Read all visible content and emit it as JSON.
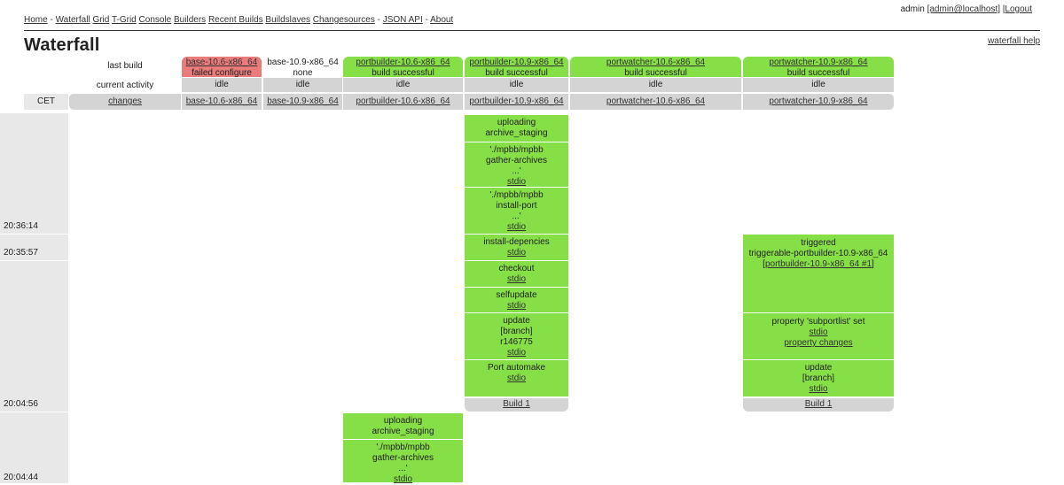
{
  "nav": {
    "items": [
      "Home",
      "Waterfall",
      "Grid",
      "T-Grid",
      "Console",
      "Builders",
      "Recent Builds",
      "Buildslaves",
      "Changesources",
      "JSON API",
      "About"
    ]
  },
  "auth": {
    "user": "admin",
    "login": "[admin@localhost]",
    "logout": "Logout"
  },
  "page": {
    "title": "Waterfall",
    "help": "waterfall help"
  },
  "rows": {
    "last_build": "last build",
    "current_activity": "current activity",
    "timezone": "CET",
    "changes": "changes"
  },
  "builders": [
    {
      "name": "base-10.6-x86_64",
      "status": "failed configure",
      "activity": "idle"
    },
    {
      "name": "base-10.9-x86_64",
      "status": "none",
      "activity": "idle"
    },
    {
      "name": "portbuilder-10.6-x86_64",
      "status": "build successful",
      "activity": "idle"
    },
    {
      "name": "portbuilder-10.9-x86_64",
      "status": "build successful",
      "activity": "idle"
    },
    {
      "name": "portwatcher-10.6-x86_64",
      "status": "build successful",
      "activity": "idle"
    },
    {
      "name": "portwatcher-10.9-x86_64",
      "status": "build successful",
      "activity": "idle"
    }
  ],
  "times": [
    "20:36:14",
    "20:35:57",
    "20:04:56",
    "20:04:44"
  ],
  "pb109": {
    "s1": [
      "uploading",
      "archive_staging"
    ],
    "s2": [
      "'./mpbb/mpbb",
      "gather-archives",
      "...'",
      "stdio"
    ],
    "s3": [
      "'./mpbb/mpbb",
      "install-port",
      "...'",
      "stdio"
    ],
    "s4": [
      "install-depencies",
      "stdio"
    ],
    "s5": [
      "checkout",
      "stdio"
    ],
    "s6": [
      "selfupdate",
      "stdio"
    ],
    "s7": [
      "update",
      "[branch]",
      "r146775",
      "stdio"
    ],
    "s8": [
      "Port automake",
      "stdio"
    ],
    "build": "Build 1"
  },
  "pw109": {
    "s1": [
      "triggered",
      "triggerable-portbuilder-10.9-x86_64",
      "[",
      "portbuilder-10.9-x86_64 #1",
      "]"
    ],
    "s2": [
      "property 'subportlist' set",
      "stdio",
      "property changes"
    ],
    "s3": [
      "update",
      "[branch]",
      "stdio"
    ],
    "build": "Build 1"
  },
  "pb106": {
    "s1": [
      "uploading",
      "archive_staging"
    ],
    "s2": [
      "'./mpbb/mpbb",
      "gather-archives",
      "...'",
      "stdio"
    ]
  }
}
